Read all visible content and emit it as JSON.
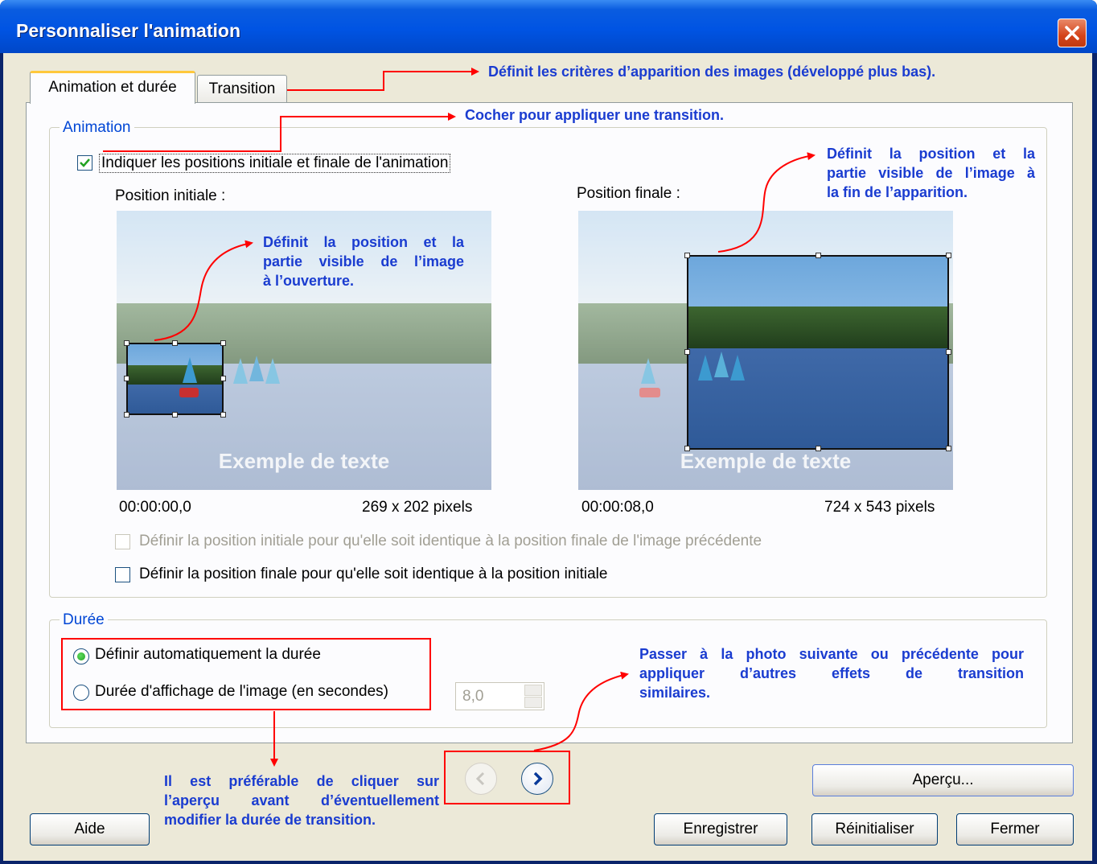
{
  "window": {
    "title": "Personnaliser l'animation",
    "close_icon": "close-icon"
  },
  "tabs": [
    {
      "label": "Animation et durée"
    },
    {
      "label": "Transition"
    }
  ],
  "animation_group": {
    "legend": "Animation",
    "indicate_positions_label": "Indiquer les positions initiale et finale de l'animation",
    "indicate_positions_checked": true,
    "initial": {
      "label": "Position initiale :",
      "time": "00:00:00,0",
      "size": "269 x 202 pixels",
      "sample_text": "Exemple de texte"
    },
    "final": {
      "label": "Position finale :",
      "time": "00:00:08,0",
      "size": "724 x 543 pixels",
      "sample_text": "Exemple de texte"
    },
    "same_as_previous_label": "Définir la position initiale pour qu'elle soit identique à la position finale de l'image précédente",
    "same_as_previous_enabled": false,
    "same_as_initial_label": "Définir la position finale pour qu'elle soit identique à la position initiale",
    "same_as_initial_checked": false
  },
  "duration_group": {
    "legend": "Durée",
    "auto_label": "Définir automatiquement la durée",
    "manual_label": "Durée d'affichage de l'image (en secondes)",
    "selected": "auto",
    "seconds_value": "8,0"
  },
  "buttons": {
    "help": "Aide",
    "preview": "Aperçu...",
    "save": "Enregistrer",
    "reset": "Réinitialiser",
    "close": "Fermer",
    "prev_icon": "chevron-left-icon",
    "next_icon": "chevron-right-icon"
  },
  "annotations": {
    "transition_tab": "Définit les critères d’apparition des images (développé plus bas).",
    "checkbox": "Cocher pour appliquer une transition.",
    "final_l1": "Définit la position et la",
    "final_l2": "partie visible de l’image à",
    "final_l3": "la fin de l’apparition.",
    "initial_l1": "Définit la position et la",
    "initial_l2": "partie visible de l’image",
    "initial_l3": "à l’ouverture.",
    "nav_l1": "Passer à la photo suivante ou précédente pour",
    "nav_l2": "appliquer d’autres effets de transition",
    "nav_l3": "similaires.",
    "duration_l1": "Il est préférable de cliquer sur",
    "duration_l2": "l’aperçu avant d’éventuellement",
    "duration_l3": "modifier la durée de transition."
  },
  "colors": {
    "annotation_text": "#1a3cd0",
    "annotation_arrow": "#ff0000",
    "titlebar": "#0054e3",
    "dialog_bg": "#ece9d8",
    "legend": "#0046d5"
  }
}
